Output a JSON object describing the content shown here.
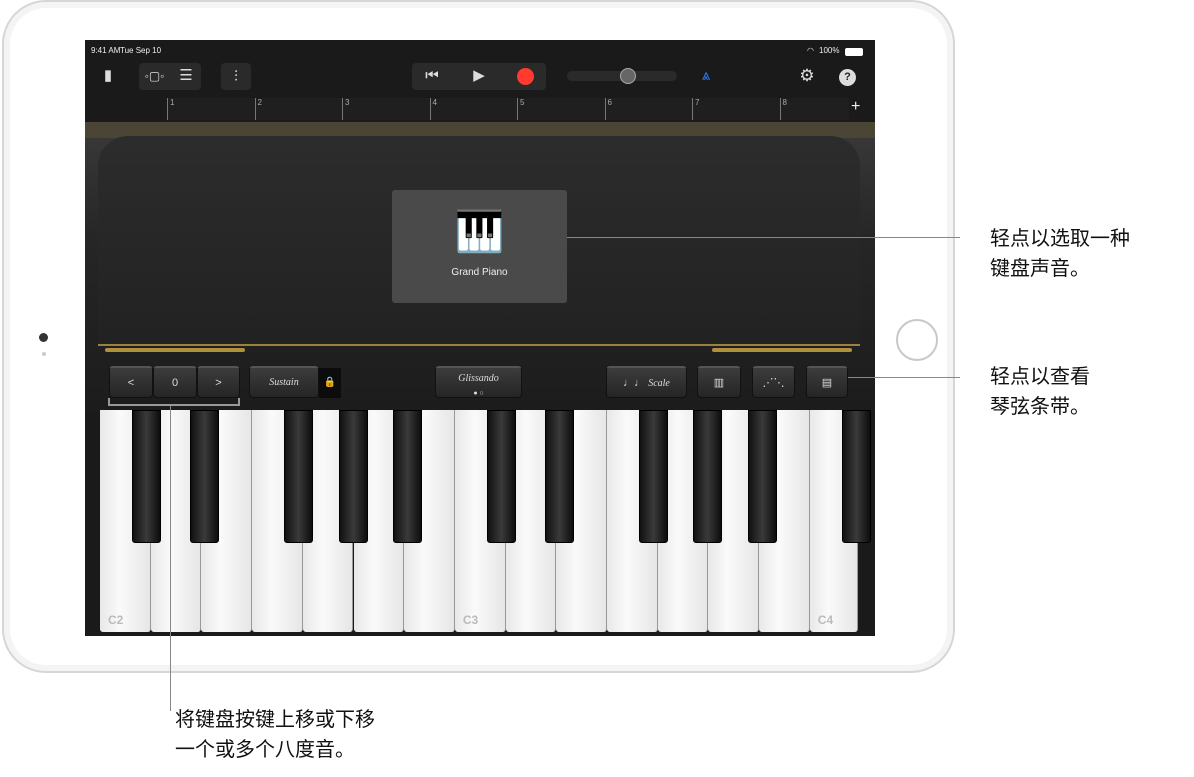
{
  "status": {
    "time": "9:41 AM",
    "date": "Tue Sep 10",
    "battery": "100%"
  },
  "toolbar": {
    "icons": [
      "new-document-icon",
      "tracks-view-icon",
      "track-list-icon",
      "mixer-icon",
      "rewind-icon",
      "play-icon",
      "record-icon",
      "metronome-icon",
      "settings-icon",
      "help-icon"
    ],
    "record_color": "#ff3b30",
    "metronome_color": "#2f7cf6",
    "help": "?"
  },
  "ruler": {
    "bars": [
      "1",
      "2",
      "3",
      "4",
      "5",
      "6",
      "7",
      "8"
    ],
    "add": "+"
  },
  "instrument": {
    "name": "Grand Piano"
  },
  "controls": {
    "octave_down": "<",
    "octave_value": "0",
    "octave_up": ">",
    "sustain": "Sustain",
    "glissando": "Glissando",
    "scale": "Scale",
    "scale_icon": "♩♩"
  },
  "keyboard": {
    "labels": [
      "C2",
      "C3",
      "C4"
    ]
  },
  "callouts": {
    "sound": [
      "轻点以选取一种",
      "键盘声音。"
    ],
    "strip": [
      "轻点以查看",
      "琴弦条带。"
    ],
    "octave": [
      "将键盘按键上移或下移",
      "一个或多个八度音。"
    ]
  }
}
